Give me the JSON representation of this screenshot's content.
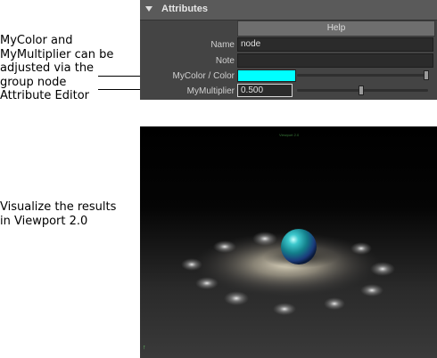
{
  "captions": {
    "top": "MyColor and MyMultiplier can be adjusted via the group node Attribute Editor",
    "bottom": "Visualize the results in Viewport 2.0"
  },
  "attribute_editor": {
    "section_title": "Attributes",
    "help_label": "Help",
    "name_label": "Name",
    "name_value": "node",
    "note_label": "Note",
    "note_value": "",
    "color_label": "MyColor / Color",
    "color_value": "#00ffff",
    "multiplier_label": "MyMultiplier",
    "multiplier_value": "0.500"
  },
  "viewport": {
    "label": "Viewport 2.0",
    "sphere_color": "#1aa8b0"
  }
}
